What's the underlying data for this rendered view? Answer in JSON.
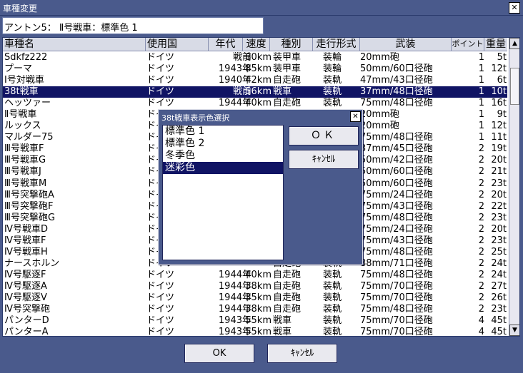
{
  "window": {
    "title": "車種変更",
    "close_glyph": "✕"
  },
  "unit_label": "アントン5： Ⅱ号戦車：標準色 1",
  "table": {
    "columns": [
      "車種名",
      "使用国",
      "年代",
      "速度",
      "種別",
      "走行形式",
      "武装",
      "ポイント",
      "重量"
    ],
    "rows": [
      [
        "Sdkfz222",
        "ドイツ",
        "戦前",
        "80km",
        "装甲車",
        "装輪",
        "20mm砲",
        "1",
        "5t"
      ],
      [
        "プーマ",
        "ドイツ",
        "1943年",
        "85km",
        "装甲車",
        "装輪",
        "50mm/60口径砲",
        "1",
        "12t"
      ],
      [
        "Ⅰ号対戦車",
        "ドイツ",
        "1940年",
        "42km",
        "自走砲",
        "装軌",
        "47mm/43口径砲",
        "1",
        "6t"
      ],
      [
        "38t戦車",
        "ドイツ",
        "戦前",
        "56km",
        "戦車",
        "装軌",
        "37mm/48口径砲",
        "1",
        "10t"
      ],
      [
        "ヘッツァー",
        "ドイツ",
        "1944年",
        "40km",
        "自走砲",
        "装軌",
        "75mm/48口径砲",
        "1",
        "16t"
      ],
      [
        "Ⅱ号戦車",
        "ドイツ",
        "",
        "",
        "",
        "",
        "20mm砲",
        "1",
        "9t"
      ],
      [
        "ルックス",
        "ドイツ",
        "",
        "",
        "",
        "",
        "20mm砲",
        "1",
        "12t"
      ],
      [
        "マルダー75",
        "ドイツ",
        "",
        "",
        "",
        "",
        "75mm/48口径砲",
        "1",
        "11t"
      ],
      [
        "Ⅲ号戦車F",
        "ドイツ",
        "",
        "",
        "",
        "",
        "37mm/45口径砲",
        "2",
        "19t"
      ],
      [
        "Ⅲ号戦車G",
        "ドイツ",
        "",
        "",
        "",
        "",
        "50mm/42口径砲",
        "2",
        "20t"
      ],
      [
        "Ⅲ号戦車J",
        "ドイツ",
        "",
        "",
        "",
        "",
        "50mm/60口径砲",
        "2",
        "21t"
      ],
      [
        "Ⅲ号戦車M",
        "ドイツ",
        "",
        "",
        "",
        "",
        "50mm/60口径砲",
        "2",
        "23t"
      ],
      [
        "Ⅲ号突撃砲A",
        "ドイツ",
        "",
        "",
        "",
        "",
        "75mm/24口径砲",
        "2",
        "20t"
      ],
      [
        "Ⅲ号突撃砲F",
        "ドイツ",
        "",
        "",
        "",
        "",
        "75mm/43口径砲",
        "2",
        "22t"
      ],
      [
        "Ⅲ号突撃砲G",
        "ドイツ",
        "",
        "",
        "",
        "",
        "75mm/48口径砲",
        "2",
        "23t"
      ],
      [
        "Ⅳ号戦車D",
        "ドイツ",
        "",
        "",
        "",
        "",
        "75mm/24口径砲",
        "2",
        "20t"
      ],
      [
        "Ⅳ号戦車F",
        "ドイツ",
        "",
        "",
        "",
        "",
        "75mm/43口径砲",
        "2",
        "23t"
      ],
      [
        "Ⅳ号戦車H",
        "ドイツ",
        "",
        "",
        "",
        "",
        "75mm/48口径砲",
        "2",
        "25t"
      ],
      [
        "ナースホルン",
        "ドイツ",
        "",
        "",
        "自走砲",
        "装軌",
        "88mm/71口径砲",
        "2",
        "24t"
      ],
      [
        "Ⅳ号駆逐F",
        "ドイツ",
        "1944年",
        "40km",
        "自走砲",
        "装軌",
        "75mm/48口径砲",
        "2",
        "24t"
      ],
      [
        "Ⅳ号駆逐A",
        "ドイツ",
        "1944年",
        "38km",
        "自走砲",
        "装軌",
        "75mm/70口径砲",
        "2",
        "27t"
      ],
      [
        "Ⅳ号駆逐V",
        "ドイツ",
        "1944年",
        "35km",
        "自走砲",
        "装軌",
        "75mm/70口径砲",
        "2",
        "26t"
      ],
      [
        "Ⅳ号突撃砲",
        "ドイツ",
        "1944年",
        "38km",
        "自走砲",
        "装軌",
        "75mm/48口径砲",
        "2",
        "23t"
      ],
      [
        "パンターD",
        "ドイツ",
        "1943年",
        "55km",
        "戦車",
        "装軌",
        "75mm/70口径砲",
        "4",
        "45t"
      ],
      [
        "パンターA",
        "ドイツ",
        "1943年",
        "55km",
        "戦車",
        "装軌",
        "75mm/70口径砲",
        "4",
        "45t"
      ]
    ],
    "selected_row": 3,
    "scroll_up_glyph": "▲",
    "scroll_down_glyph": "▼"
  },
  "buttons": {
    "ok": "OK",
    "cancel": "ｷｬﾝｾﾙ"
  },
  "dialog": {
    "title": "38t戦車表示色選択",
    "close_glyph": "✕",
    "options": [
      "標準色 1",
      "標準色 2",
      "冬季色",
      "迷彩色"
    ],
    "selected_option": 3,
    "ok": "ＯＫ",
    "cancel": "ｷｬﾝｾﾙ"
  }
}
